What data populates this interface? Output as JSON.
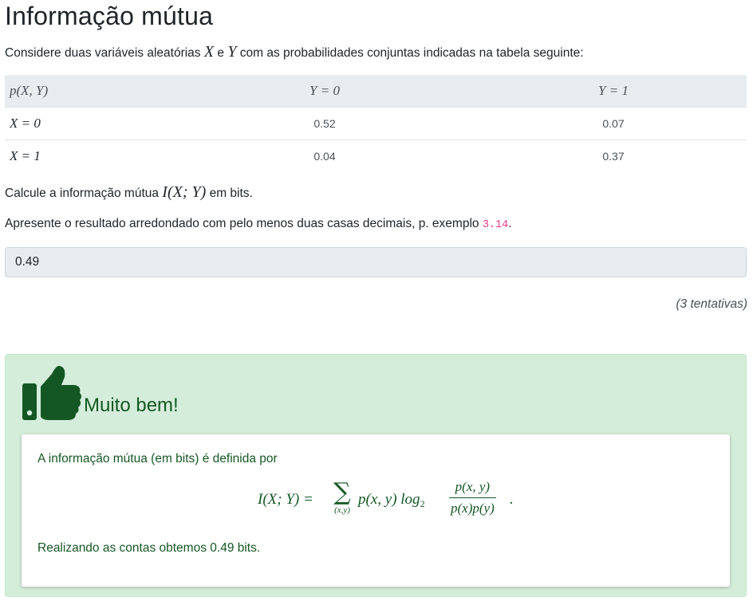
{
  "page": {
    "title": "Informação mútua"
  },
  "intro": {
    "before": "Considere duas variáveis aleatórias ",
    "var_x": "X",
    "conj": " e ",
    "var_y": "Y",
    "after": " com as probabilidades conjuntas indicadas na tabela seguinte:"
  },
  "table": {
    "headers": [
      "p(X, Y)",
      "Y = 0",
      "Y = 1"
    ],
    "rows": [
      {
        "label": "X = 0",
        "values": [
          "0.52",
          "0.07"
        ]
      },
      {
        "label": "X = 1",
        "values": [
          "0.04",
          "0.37"
        ]
      }
    ]
  },
  "question": {
    "before": "Calcule a informação mútua ",
    "expr": "I(X; Y)",
    "after": " em bits.",
    "format_before": "Apresente o resultado arredondado com pelo menos duas casas decimais, p. exemplo ",
    "format_example": "3.14",
    "format_after": "."
  },
  "answer": {
    "value": "0.49"
  },
  "attempts": "(3 tentativas)",
  "feedback": {
    "icon": "thumbs-up-icon",
    "verdict": "Muito bem!",
    "explanation_intro": "A informação mútua (em bits) é definida por",
    "formula": {
      "lhs": "I(X; Y) =",
      "sum_symbol": "∑",
      "sum_sub": "(x,y)",
      "term": "p(x, y) log",
      "log_base": "2",
      "frac_num": "p(x, y)",
      "frac_den": "p(x)p(y)",
      "end": "."
    },
    "conclusion": "Realizando as contas obtemos 0.49 bits."
  },
  "colors": {
    "success_bg": "#d4edda",
    "success_text": "#155724",
    "thumb_icon": "#155724",
    "table_header_bg": "#e9ecef",
    "code_color": "#e83e8c"
  }
}
